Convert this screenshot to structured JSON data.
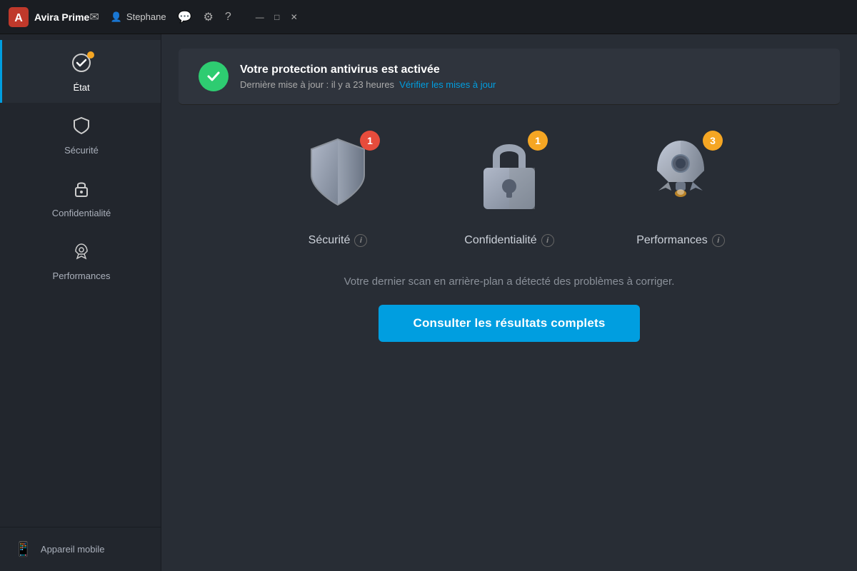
{
  "titlebar": {
    "logo_text": "Avira Prime",
    "user_icon": "👤",
    "username": "Stephane",
    "mail_icon": "✉",
    "chat_icon": "💬",
    "gear_icon": "⚙",
    "help_icon": "?",
    "min_icon": "—",
    "max_icon": "□",
    "close_icon": "✕"
  },
  "sidebar": {
    "items": [
      {
        "id": "etat",
        "label": "État",
        "icon": "etat-icon",
        "active": true,
        "has_dot": true
      },
      {
        "id": "securite",
        "label": "Sécurité",
        "icon": "shield-icon",
        "active": false,
        "has_dot": false
      },
      {
        "id": "confidentialite",
        "label": "Confidentialité",
        "icon": "lock-icon",
        "active": false,
        "has_dot": false
      },
      {
        "id": "performances",
        "label": "Performances",
        "icon": "rocket-icon",
        "active": false,
        "has_dot": false
      }
    ],
    "mobile_label": "Appareil mobile"
  },
  "status": {
    "title": "Votre protection antivirus est activée",
    "subtitle": "Dernière mise à jour : il y a 23 heures",
    "update_link": "Vérifier les mises à jour"
  },
  "cards": [
    {
      "id": "securite",
      "label": "Sécurité",
      "badge": "1",
      "badge_type": "red",
      "info_label": "i"
    },
    {
      "id": "confidentialite",
      "label": "Confidentialité",
      "badge": "1",
      "badge_type": "orange",
      "info_label": "i"
    },
    {
      "id": "performances",
      "label": "Performances",
      "badge": "3",
      "badge_type": "orange",
      "info_label": "i"
    }
  ],
  "scan": {
    "result_text": "Votre dernier scan en arrière-plan a détecté des problèmes à corriger.",
    "button_label": "Consulter les résultats complets"
  }
}
